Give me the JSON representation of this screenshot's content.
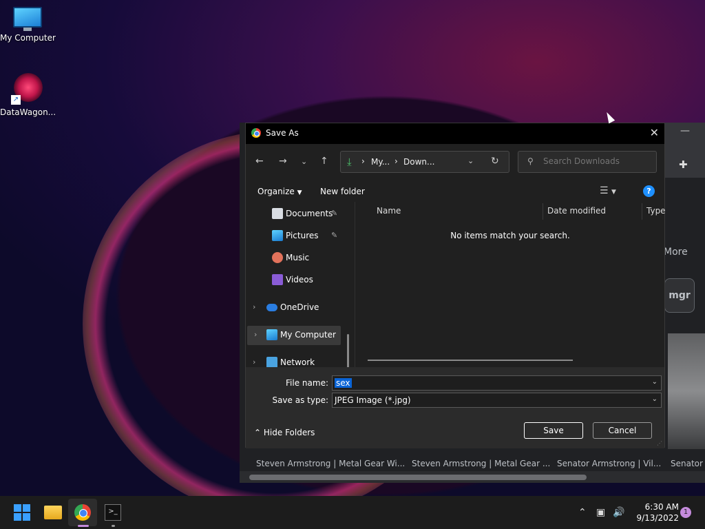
{
  "desktop": {
    "icons": [
      {
        "label": "My Computer"
      },
      {
        "label": "DataWagon..."
      }
    ]
  },
  "browser": {
    "more_label": "More",
    "chip_label": "mgr",
    "captions": [
      "Steven Armstrong | Metal Gear Wi...",
      "Steven Armstrong | Metal Gear ...",
      "Senator Armstrong | Vil...",
      "Senator A"
    ]
  },
  "dialog": {
    "title": "Save As",
    "address": {
      "crumbs": [
        "My...",
        "Down..."
      ]
    },
    "search": {
      "placeholder": "Search Downloads"
    },
    "toolbar": {
      "organize_label": "Organize",
      "new_folder_label": "New folder"
    },
    "nav_items": [
      {
        "label": "Documents",
        "pinned": true,
        "icon": "documents-icon"
      },
      {
        "label": "Pictures",
        "pinned": true,
        "icon": "pictures-icon"
      },
      {
        "label": "Music",
        "pinned": false,
        "icon": "music-icon"
      },
      {
        "label": "Videos",
        "pinned": false,
        "icon": "videos-icon"
      },
      {
        "label": "OneDrive",
        "pinned": false,
        "icon": "cloud-icon"
      },
      {
        "label": "My Computer",
        "pinned": false,
        "icon": "computer-icon"
      },
      {
        "label": "Network",
        "pinned": false,
        "icon": "network-icon"
      }
    ],
    "columns": [
      "Name",
      "Date modified",
      "Type"
    ],
    "empty_message": "No items match your search.",
    "file_name_label": "File name:",
    "file_name_value": "sex",
    "save_type_label": "Save as type:",
    "save_type_value": "JPEG Image (*.jpg)",
    "hide_folders_label": "Hide Folders",
    "save_label": "Save",
    "cancel_label": "Cancel"
  },
  "taskbar": {
    "time": "6:30 AM",
    "date": "9/13/2022",
    "notification_count": "1"
  },
  "colors": {
    "accent": "#0a64d6",
    "help": "#1e90ff",
    "download": "#4cc26b"
  }
}
